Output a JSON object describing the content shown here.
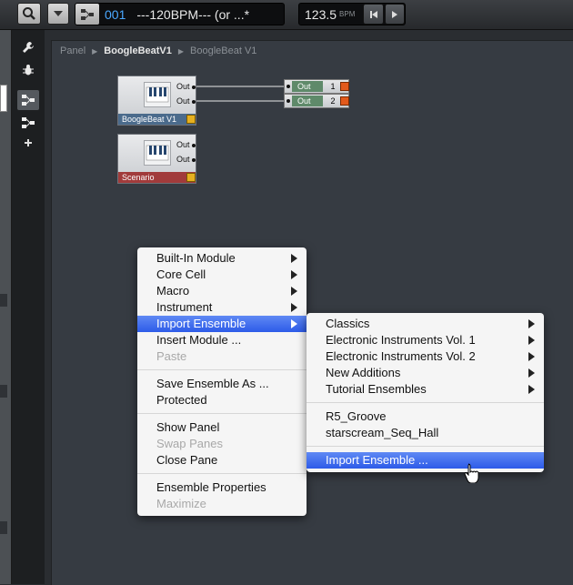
{
  "toolbar": {
    "ensemble_number": "001",
    "ensemble_name": "---120BPM--- (or ...*",
    "tempo_value": "123.5",
    "tempo_unit": "BPM"
  },
  "breadcrumb": [
    "Panel",
    "BoogleBeatV1",
    "BoogleBeat V1"
  ],
  "modules": {
    "instrument1": {
      "label": "BoogleBeat V1",
      "ports": [
        "Out",
        "Out"
      ],
      "label_color": "#4b6b8c"
    },
    "instrument2": {
      "label": "Scenario",
      "ports": [
        "Out",
        "Out"
      ],
      "label_color": "#a13b3b"
    },
    "out1": {
      "label": "Out",
      "channel": "1"
    },
    "out2": {
      "label": "Out",
      "channel": "2"
    }
  },
  "context_menu": {
    "items": [
      {
        "label": "Built-In Module",
        "submenu": true
      },
      {
        "label": "Core Cell",
        "submenu": true
      },
      {
        "label": "Macro",
        "submenu": true
      },
      {
        "label": "Instrument",
        "submenu": true
      },
      {
        "label": "Import Ensemble",
        "submenu": true,
        "highlighted": true
      },
      {
        "label": "Insert Module ..."
      },
      {
        "label": "Paste",
        "disabled": true
      },
      {
        "label": "Save Ensemble As ..."
      },
      {
        "label": "Protected"
      },
      {
        "label": "Show Panel"
      },
      {
        "label": "Swap Panes",
        "disabled": true
      },
      {
        "label": "Close Pane"
      },
      {
        "label": "Ensemble Properties"
      },
      {
        "label": "Maximize",
        "disabled": true
      }
    ]
  },
  "submenu": {
    "items": [
      {
        "label": "Classics",
        "submenu": true
      },
      {
        "label": "Electronic Instruments Vol. 1",
        "submenu": true
      },
      {
        "label": "Electronic Instruments Vol. 2",
        "submenu": true
      },
      {
        "label": "New Additions",
        "submenu": true
      },
      {
        "label": "Tutorial Ensembles",
        "submenu": true
      },
      {
        "label": "R5_Groove"
      },
      {
        "label": "starscream_Seq_Hall"
      },
      {
        "label": "Import Ensemble ...",
        "highlighted": true
      }
    ]
  },
  "colors": {
    "highlight": "#3b66ee",
    "tempo_text": "#4aa8ff",
    "module_accent": "#e6b020",
    "out_port_orange": "#e25a1c"
  },
  "icons": [
    "search-icon",
    "dropdown-icon",
    "structure-icon",
    "skip-back-icon",
    "play-icon",
    "wrench-icon",
    "bug-icon",
    "plus-icon"
  ]
}
